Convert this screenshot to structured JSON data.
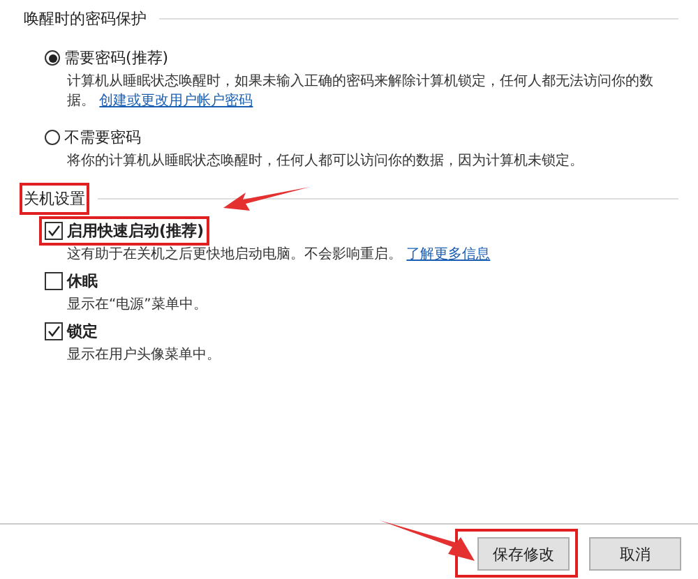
{
  "sections": [
    {
      "title": "唤醒时的密码保护",
      "highlighted": false,
      "options": [
        {
          "kind": "radio",
          "label": "需要密码(推荐)",
          "selected": true,
          "highlighted": false,
          "description": "计算机从睡眠状态唤醒时，如果未输入正确的密码来解除计算机锁定，任何人都无法访问你的数据。",
          "link": "创建或更改用户帐户密码"
        },
        {
          "kind": "radio",
          "label": "不需要密码",
          "selected": false,
          "highlighted": false,
          "description": "将你的计算机从睡眠状态唤醒时，任何人都可以访问你的数据，因为计算机未锁定。"
        }
      ]
    },
    {
      "title": "关机设置",
      "highlighted": true,
      "options": [
        {
          "kind": "checkbox",
          "label": "启用快速启动(推荐)",
          "checked": true,
          "highlighted": true,
          "description": "这有助于在关机之后更快地启动电脑。不会影响重启。",
          "link": "了解更多信息"
        },
        {
          "kind": "checkbox",
          "label": "休眠",
          "checked": false,
          "highlighted": false,
          "description": "显示在“电源”菜单中。"
        },
        {
          "kind": "checkbox",
          "label": "锁定",
          "checked": true,
          "highlighted": false,
          "description": "显示在用户头像菜单中。"
        }
      ]
    }
  ],
  "buttons": [
    {
      "label": "保存修改",
      "highlighted": true
    },
    {
      "label": "取消",
      "highlighted": false
    }
  ]
}
